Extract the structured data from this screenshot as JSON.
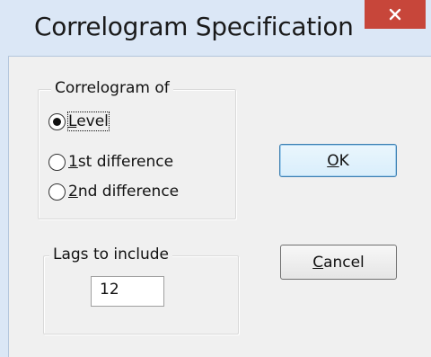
{
  "window": {
    "title": "Correlogram Specification",
    "close_icon": "close-icon"
  },
  "correlogram_group": {
    "legend": "Correlogram of",
    "options": [
      {
        "mnemonic": "L",
        "rest": "evel",
        "checked": true
      },
      {
        "mnemonic": "1",
        "rest": "st difference",
        "checked": false
      },
      {
        "mnemonic": "2",
        "rest": "nd difference",
        "checked": false
      }
    ]
  },
  "lags_group": {
    "legend": "Lags to include",
    "value": "12"
  },
  "buttons": {
    "ok": {
      "mnemonic": "O",
      "rest": "K"
    },
    "cancel": {
      "mnemonic": "C",
      "rest": "ancel"
    }
  },
  "colors": {
    "titlebar": "#dbe7f6",
    "close_button": "#c7463a",
    "client": "#f0f0f0"
  }
}
